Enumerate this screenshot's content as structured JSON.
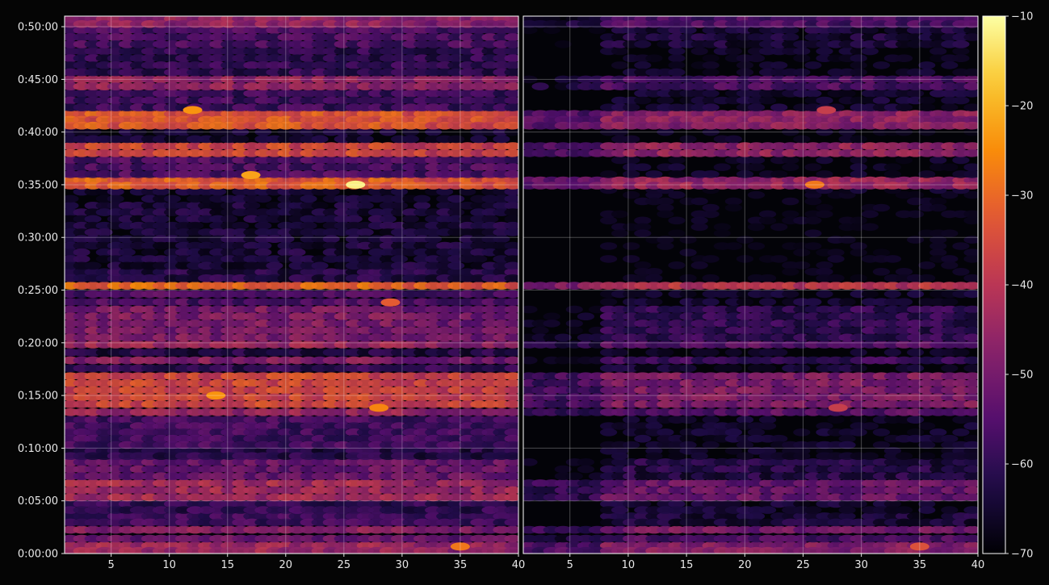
{
  "chart_data": {
    "type": "heatmap",
    "title": "",
    "xlabel": "",
    "ylabel": "",
    "colormap": "inferno",
    "background": "#050505",
    "grid": true,
    "colorbar": {
      "position": "right",
      "range": [
        -70,
        -10
      ],
      "ticks": [
        -10,
        -20,
        -30,
        -40,
        -50,
        -60,
        -70
      ],
      "tick_labels": [
        "−10",
        "−20",
        "−30",
        "−40",
        "−50",
        "−60",
        "−70"
      ]
    },
    "y_axis": {
      "range_seconds": [
        0,
        3060
      ],
      "ticks_seconds": [
        0,
        300,
        600,
        900,
        1200,
        1500,
        1800,
        2100,
        2400,
        2700,
        3000
      ],
      "tick_labels": [
        "0:00:00",
        "0:05:00",
        "0:10:00",
        "0:15:00",
        "0:20:00",
        "0:25:00",
        "0:30:00",
        "0:35:00",
        "0:40:00",
        "0:45:00",
        "0:50:00"
      ]
    },
    "panels": [
      {
        "name": "left",
        "x_range": [
          1,
          40
        ],
        "x_ticks": [
          5,
          10,
          15,
          20,
          25,
          30,
          35,
          40
        ],
        "x_tick_labels": [
          "5",
          "10",
          "15",
          "20",
          "25",
          "30",
          "35",
          "40"
        ],
        "bands": [
          {
            "t0": 0,
            "t1": 60,
            "level": -44
          },
          {
            "t0": 60,
            "t1": 110,
            "level": -52
          },
          {
            "t0": 110,
            "t1": 160,
            "level": -47
          },
          {
            "t0": 160,
            "t1": 230,
            "level": -58
          },
          {
            "t0": 230,
            "t1": 300,
            "level": -60
          },
          {
            "t0": 300,
            "t1": 420,
            "level": -43
          },
          {
            "t0": 420,
            "t1": 540,
            "level": -52
          },
          {
            "t0": 540,
            "t1": 600,
            "level": -62
          },
          {
            "t0": 600,
            "t1": 780,
            "level": -57
          },
          {
            "t0": 780,
            "t1": 830,
            "level": -45
          },
          {
            "t0": 830,
            "t1": 1030,
            "level": -36
          },
          {
            "t0": 1030,
            "t1": 1080,
            "level": -60
          },
          {
            "t0": 1080,
            "t1": 1120,
            "level": -48
          },
          {
            "t0": 1120,
            "t1": 1170,
            "level": -62
          },
          {
            "t0": 1170,
            "t1": 1210,
            "level": -44
          },
          {
            "t0": 1210,
            "t1": 1410,
            "level": -49
          },
          {
            "t0": 1410,
            "t1": 1500,
            "level": -56
          },
          {
            "t0": 1500,
            "t1": 1550,
            "level": -30
          },
          {
            "t0": 1550,
            "t1": 1620,
            "level": -62
          },
          {
            "t0": 1620,
            "t1": 2000,
            "level": -64
          },
          {
            "t0": 2000,
            "t1": 2080,
            "level": -66
          },
          {
            "t0": 2080,
            "t1": 2140,
            "level": -32
          },
          {
            "t0": 2140,
            "t1": 2260,
            "level": -56
          },
          {
            "t0": 2260,
            "t1": 2340,
            "level": -36
          },
          {
            "t0": 2340,
            "t1": 2420,
            "level": -66
          },
          {
            "t0": 2420,
            "t1": 2520,
            "level": -33
          },
          {
            "t0": 2520,
            "t1": 2640,
            "level": -58
          },
          {
            "t0": 2640,
            "t1": 2720,
            "level": -46
          },
          {
            "t0": 2720,
            "t1": 2880,
            "level": -60
          },
          {
            "t0": 2880,
            "t1": 3000,
            "level": -56
          },
          {
            "t0": 3000,
            "t1": 3060,
            "level": -46
          }
        ]
      },
      {
        "name": "right",
        "x_range": [
          1,
          40
        ],
        "x_ticks": [
          5,
          10,
          15,
          20,
          25,
          30,
          35,
          40
        ],
        "x_tick_labels": [
          "5",
          "10",
          "15",
          "20",
          "25",
          "30",
          "35",
          "40"
        ],
        "bands": [
          {
            "t0": 0,
            "t1": 60,
            "level": -48
          },
          {
            "t0": 60,
            "t1": 110,
            "level": -56
          },
          {
            "t0": 110,
            "t1": 160,
            "level": -50
          },
          {
            "t0": 160,
            "t1": 230,
            "level": -64
          },
          {
            "t0": 230,
            "t1": 300,
            "level": -66
          },
          {
            "t0": 300,
            "t1": 420,
            "level": -52
          },
          {
            "t0": 420,
            "t1": 540,
            "level": -62
          },
          {
            "t0": 540,
            "t1": 600,
            "level": -68
          },
          {
            "t0": 600,
            "t1": 780,
            "level": -67
          },
          {
            "t0": 780,
            "t1": 830,
            "level": -54
          },
          {
            "t0": 830,
            "t1": 1030,
            "level": -49
          },
          {
            "t0": 1030,
            "t1": 1080,
            "level": -66
          },
          {
            "t0": 1080,
            "t1": 1120,
            "level": -58
          },
          {
            "t0": 1120,
            "t1": 1170,
            "level": -68
          },
          {
            "t0": 1170,
            "t1": 1210,
            "level": -54
          },
          {
            "t0": 1210,
            "t1": 1410,
            "level": -60
          },
          {
            "t0": 1410,
            "t1": 1500,
            "level": -66
          },
          {
            "t0": 1500,
            "t1": 1550,
            "level": -40
          },
          {
            "t0": 1550,
            "t1": 2060,
            "level": -70
          },
          {
            "t0": 2060,
            "t1": 2080,
            "level": -68
          },
          {
            "t0": 2080,
            "t1": 2140,
            "level": -45
          },
          {
            "t0": 2140,
            "t1": 2260,
            "level": -68
          },
          {
            "t0": 2260,
            "t1": 2340,
            "level": -46
          },
          {
            "t0": 2340,
            "t1": 2420,
            "level": -69
          },
          {
            "t0": 2420,
            "t1": 2520,
            "level": -47
          },
          {
            "t0": 2520,
            "t1": 2640,
            "level": -66
          },
          {
            "t0": 2640,
            "t1": 2720,
            "level": -56
          },
          {
            "t0": 2720,
            "t1": 2880,
            "level": -68
          },
          {
            "t0": 2880,
            "t1": 3000,
            "level": -64
          },
          {
            "t0": 3000,
            "t1": 3060,
            "level": -56
          }
        ]
      }
    ],
    "hotspots": [
      {
        "panel": "left",
        "x": 26,
        "t": 2100,
        "level": -12
      },
      {
        "panel": "left",
        "x": 17,
        "t": 2155,
        "level": -22
      },
      {
        "panel": "left",
        "x": 12,
        "t": 2525,
        "level": -24
      },
      {
        "panel": "left",
        "x": 14,
        "t": 900,
        "level": -24
      },
      {
        "panel": "left",
        "x": 28,
        "t": 830,
        "level": -26
      },
      {
        "panel": "left",
        "x": 29,
        "t": 1430,
        "level": -32
      },
      {
        "panel": "left",
        "x": 35,
        "t": 40,
        "level": -28
      },
      {
        "panel": "right",
        "x": 26,
        "t": 2100,
        "level": -28
      },
      {
        "panel": "right",
        "x": 27,
        "t": 2525,
        "level": -38
      },
      {
        "panel": "right",
        "x": 28,
        "t": 830,
        "level": -38
      },
      {
        "panel": "right",
        "x": 35,
        "t": 40,
        "level": -34
      }
    ]
  }
}
